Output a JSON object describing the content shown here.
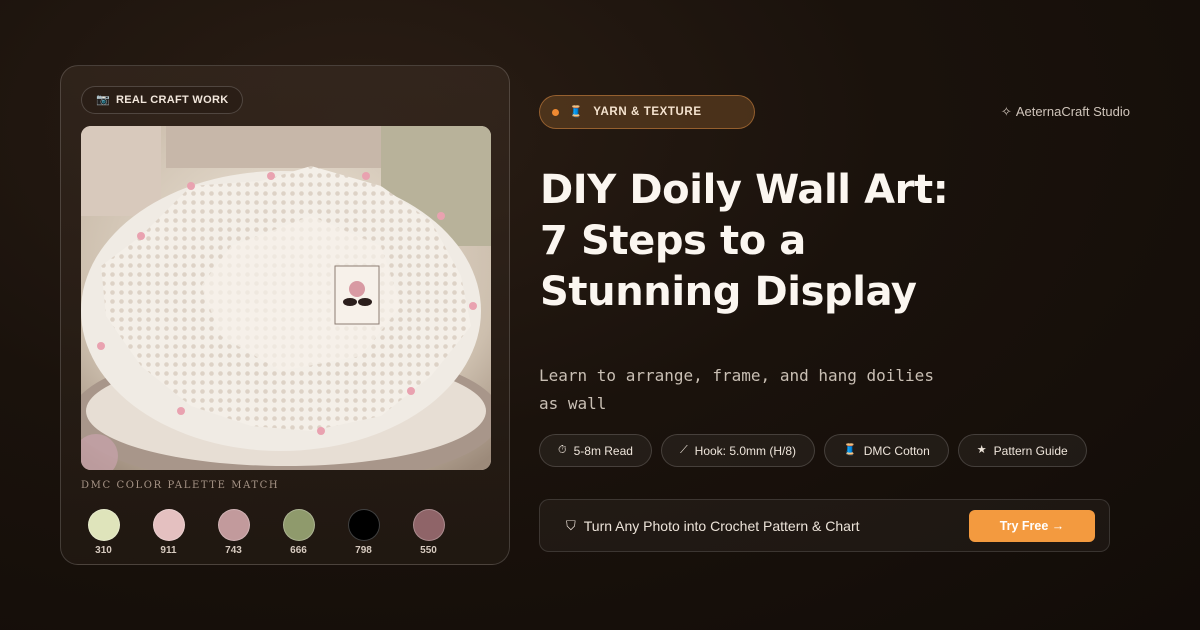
{
  "card": {
    "badge_icon": "camera-icon",
    "badge_label": "REAL CRAFT WORK",
    "photo_alt": "crocheted doily on a cake stand",
    "palette_title": "DMC COLOR PALETTE MATCH",
    "swatches": [
      {
        "code": "310",
        "color": "#dfe4bb"
      },
      {
        "code": "911",
        "color": "#e4c0c0"
      },
      {
        "code": "743",
        "color": "#c29a9c"
      },
      {
        "code": "666",
        "color": "#8f9a6c"
      },
      {
        "code": "798",
        "color": "#000000"
      },
      {
        "code": "550",
        "color": "#8f6468"
      }
    ]
  },
  "header": {
    "tag_label": "YARN & TEXTURE",
    "tag_icon": "yarn-spool-icon",
    "brand_icon": "sparkle-icon",
    "brand_name": "AeternaCraft Studio"
  },
  "article": {
    "title": "DIY Doily Wall Art: 7 Steps to a Stunning Display",
    "subtitle": "Learn to arrange, frame, and hang doilies as wall"
  },
  "chips": [
    {
      "icon": "stopwatch-icon",
      "label": "5-8m Read"
    },
    {
      "icon": "crochet-hook-icon",
      "label": "Hook: 5.0mm (H/8)"
    },
    {
      "icon": "yarn-spool-icon",
      "label": "DMC Cotton"
    },
    {
      "icon": "star-icon",
      "label": "Pattern Guide"
    }
  ],
  "cta": {
    "icon": "shield-icon",
    "text": "Turn Any Photo into Crochet Pattern & Chart",
    "button_label": "Try Free →"
  },
  "colors": {
    "accent": "#f39a3f",
    "background": "#1a120c"
  }
}
